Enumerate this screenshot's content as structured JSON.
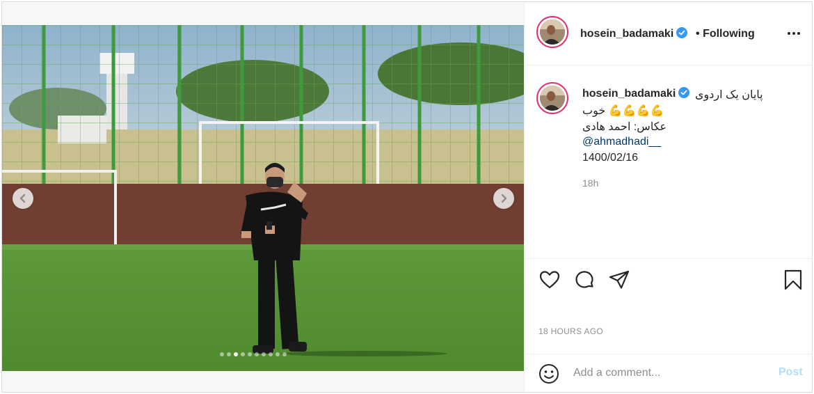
{
  "post": {
    "username": "hosein_badamaki",
    "follow_separator": "•",
    "follow_status": "Following",
    "caption": {
      "line1": "پایان یک اردوی",
      "line2_text": "خوب",
      "line2_emoji": "💪💪💪💪",
      "line3": "عکاس: احمد هادی",
      "mention": "@ahmadhadi__",
      "date": "1400/02/16",
      "relative_time": "18h"
    },
    "timestamp": "18 HOURS AGO",
    "comment": {
      "placeholder": "Add a comment...",
      "value": "",
      "post_label": "Post"
    },
    "carousel": {
      "total_slides": 10,
      "active_index": 2
    }
  },
  "icons": {
    "verified": "verified-badge-icon",
    "more": "more-options-icon",
    "like": "heart-icon",
    "comment": "comment-bubble-icon",
    "share": "paper-plane-icon",
    "save": "bookmark-icon",
    "emoji": "smiley-icon",
    "prev": "chevron-left-icon",
    "next": "chevron-right-icon"
  },
  "colors": {
    "verified": "#3897f0",
    "link": "#00376b",
    "muted": "#8e8e8e",
    "post_disabled": "#b2dffc",
    "story_ring": "#e1306c"
  }
}
